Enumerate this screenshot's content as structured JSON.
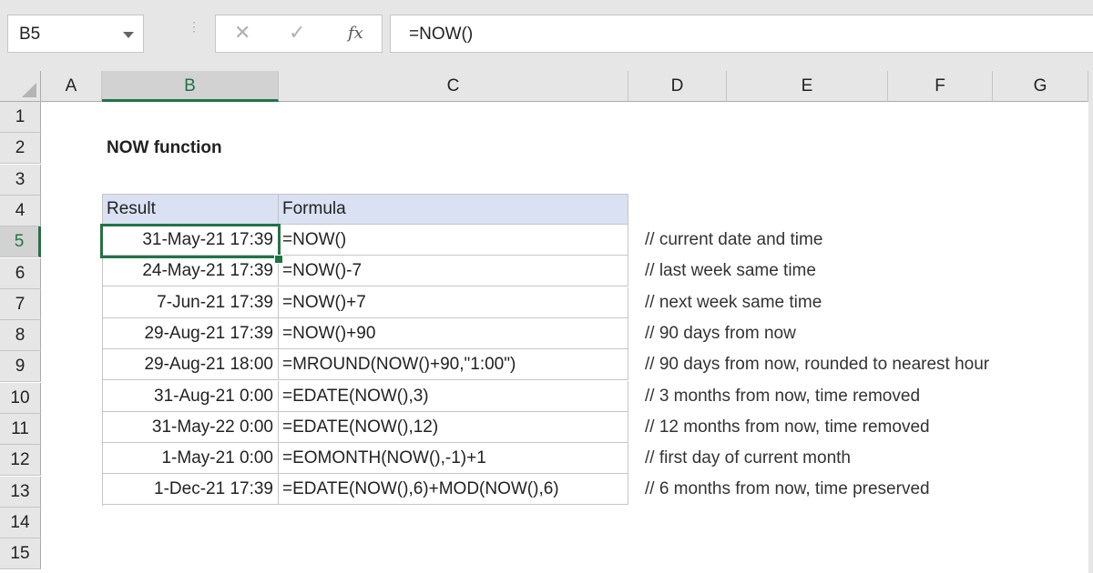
{
  "toolbar": {
    "name_box": "B5",
    "cancel_icon": "✕",
    "confirm_icon": "✓",
    "fx_label": "fx",
    "formula": "=NOW()"
  },
  "columns": [
    "A",
    "B",
    "C",
    "D",
    "E",
    "F",
    "G"
  ],
  "selected_column": "B",
  "rows": [
    "1",
    "2",
    "3",
    "4",
    "5",
    "6",
    "7",
    "8",
    "9",
    "10",
    "11",
    "12",
    "13",
    "14",
    "15"
  ],
  "selected_row": "5",
  "sheet": {
    "title": "NOW function",
    "headers": {
      "result": "Result",
      "formula": "Formula"
    },
    "table": [
      {
        "result": "31-May-21 17:39",
        "formula": "=NOW()",
        "comment": "// current date and time"
      },
      {
        "result": "24-May-21 17:39",
        "formula": "=NOW()-7",
        "comment": "// last week same time"
      },
      {
        "result": "7-Jun-21 17:39",
        "formula": "=NOW()+7",
        "comment": "// next week same time"
      },
      {
        "result": "29-Aug-21 17:39",
        "formula": "=NOW()+90",
        "comment": "// 90 days from now"
      },
      {
        "result": "29-Aug-21 18:00",
        "formula": "=MROUND(NOW()+90,\"1:00\")",
        "comment": "// 90 days from now, rounded to nearest hour"
      },
      {
        "result": "31-Aug-21 0:00",
        "formula": "=EDATE(NOW(),3)",
        "comment": "// 3 months from now, time removed"
      },
      {
        "result": "31-May-22 0:00",
        "formula": "=EDATE(NOW(),12)",
        "comment": "// 12 months from now, time removed"
      },
      {
        "result": "1-May-21 0:00",
        "formula": "=EOMONTH(NOW(),-1)+1",
        "comment": "// first day of current month"
      },
      {
        "result": "1-Dec-21 17:39",
        "formula": "=EDATE(NOW(),6)+MOD(NOW(),6)",
        "comment": "// 6 months from now, time preserved"
      }
    ]
  }
}
